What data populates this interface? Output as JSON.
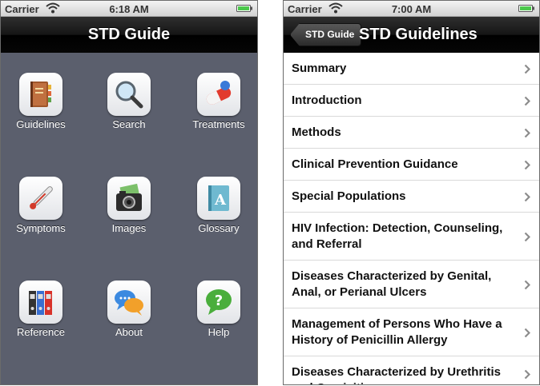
{
  "left_screen": {
    "status": {
      "carrier": "Carrier",
      "time": "6:18 AM"
    },
    "nav": {
      "title": "STD Guide"
    },
    "grid": [
      {
        "label": "Guidelines",
        "icon": "book-icon"
      },
      {
        "label": "Search",
        "icon": "magnifier-icon"
      },
      {
        "label": "Treatments",
        "icon": "pill-icon"
      },
      {
        "label": "Symptoms",
        "icon": "thermometer-icon"
      },
      {
        "label": "Images",
        "icon": "camera-icon"
      },
      {
        "label": "Glossary",
        "icon": "glossary-book-icon"
      },
      {
        "label": "Reference",
        "icon": "binders-icon"
      },
      {
        "label": "About",
        "icon": "speech-bubbles-icon"
      },
      {
        "label": "Help",
        "icon": "help-bubble-icon"
      }
    ]
  },
  "right_screen": {
    "status": {
      "carrier": "Carrier",
      "time": "7:00 AM"
    },
    "nav": {
      "back_label": "STD Guide",
      "title": "STD Guidelines"
    },
    "rows": [
      "Summary",
      "Introduction",
      "Methods",
      "Clinical Prevention Guidance",
      "Special Populations",
      "HIV Infection: Detection, Counseling, and Referral",
      "Diseases Characterized by Genital, Anal, or Perianal Ulcers",
      "Management of Persons Who Have a History of Penicillin Allergy",
      "Diseases Characterized by Urethritis and Cervicitis"
    ]
  },
  "colors": {
    "home_background": "#5b5f6d",
    "nav_bar": "#000000",
    "battery": "#4cc84c"
  }
}
